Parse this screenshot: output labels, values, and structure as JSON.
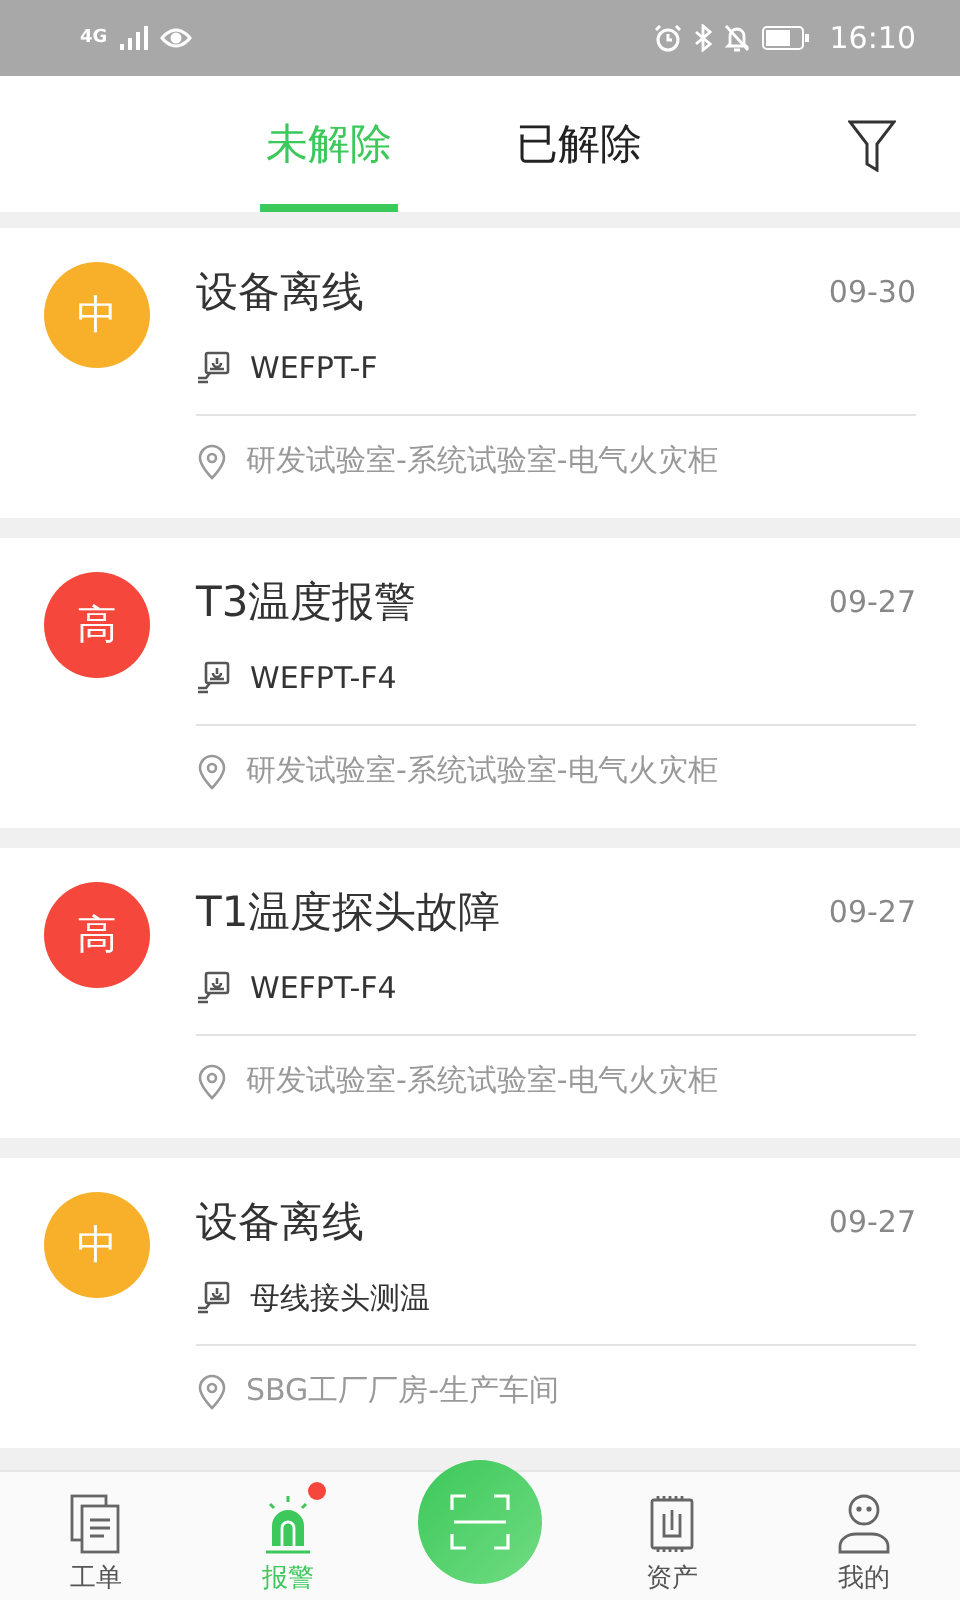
{
  "status_bar": {
    "network": "4G",
    "time": "16:10"
  },
  "tabs": [
    {
      "label": "未解除",
      "selected": true
    },
    {
      "label": "已解除",
      "selected": false
    }
  ],
  "alarms": [
    {
      "level": "中",
      "color": "#f8b02a",
      "title": "设备离线",
      "date": "09-30",
      "device": "WEFPT-F",
      "location": "研发试验室-系统试验室-电气火灾柜"
    },
    {
      "level": "高",
      "color": "#f5473b",
      "title": "T3温度报警",
      "date": "09-27",
      "device": "WEFPT-F4",
      "location": "研发试验室-系统试验室-电气火灾柜"
    },
    {
      "level": "高",
      "color": "#f5473b",
      "title": "T1温度探头故障",
      "date": "09-27",
      "device": "WEFPT-F4",
      "location": "研发试验室-系统试验室-电气火灾柜"
    },
    {
      "level": "中",
      "color": "#f8b02a",
      "title": "设备离线",
      "date": "09-27",
      "device": "母线接头测温",
      "location": "SBG工厂厂房-生产车间"
    }
  ],
  "nav": [
    {
      "kind": "orders",
      "label": "工单",
      "selected": false,
      "badge": false
    },
    {
      "kind": "alarm",
      "label": "报警",
      "selected": true,
      "badge": true
    },
    {
      "kind": "scan"
    },
    {
      "kind": "assets",
      "label": "资产",
      "selected": false,
      "badge": false
    },
    {
      "kind": "profile",
      "label": "我的",
      "selected": false,
      "badge": false
    }
  ]
}
